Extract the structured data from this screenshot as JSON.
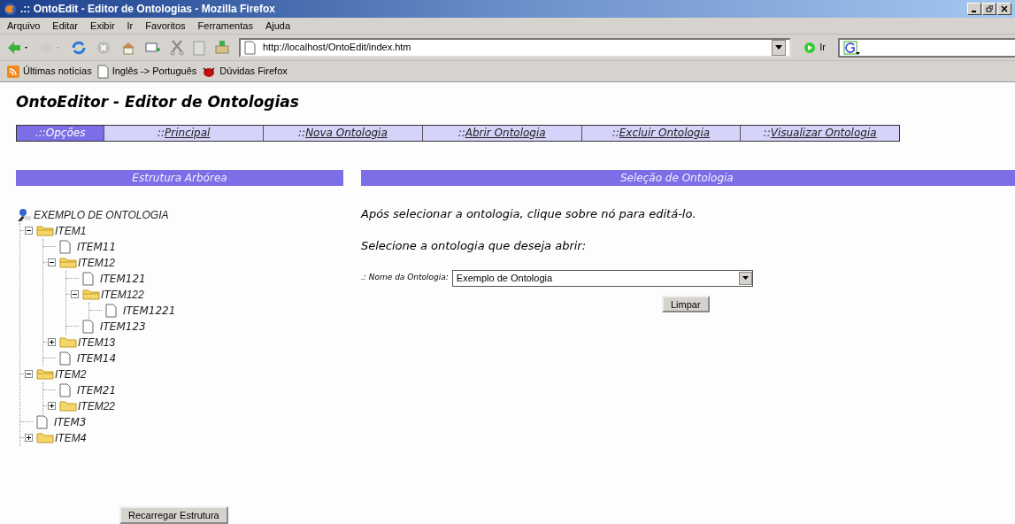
{
  "window": {
    "title": ".:: OntoEdit - Editor de Ontologias - Mozilla Firefox"
  },
  "menu": [
    "Arquivo",
    "Editar",
    "Exibir",
    "Ir",
    "Favoritos",
    "Ferramentas",
    "Ajuda"
  ],
  "address": {
    "value": "http://localhost/OntoEdit/index.htm",
    "go": "Ir"
  },
  "bookmarks": [
    {
      "kind": "feed",
      "label": "Últimas notícias"
    },
    {
      "kind": "page",
      "label": "Inglês -> Português"
    },
    {
      "kind": "bug",
      "label": "Dúvidas Firefox"
    }
  ],
  "page_title": "OntoEditor - Editor de Ontologias",
  "nav": [
    {
      "prefix": ".:: ",
      "label": "Opções",
      "selected": true
    },
    {
      "prefix": ":: ",
      "label": "Principal",
      "selected": false
    },
    {
      "prefix": "::",
      "label": "Nova Ontologia",
      "selected": false
    },
    {
      "prefix": "::",
      "label": "Abrir Ontologia",
      "selected": false
    },
    {
      "prefix": "::",
      "label": "Excluir Ontologia",
      "selected": false
    },
    {
      "prefix": "::",
      "label": "Visualizar Ontologia",
      "selected": false
    }
  ],
  "tree_panel": {
    "header": "Estrutura Arbórea",
    "root": "EXEMPLO DE ONTOLOGIA",
    "button": "Recarregar Estrutura",
    "items": [
      {
        "kind": "folder",
        "label": "ITEM1",
        "expanded": true,
        "children": [
          {
            "kind": "file",
            "label": "ITEM11"
          },
          {
            "kind": "folder",
            "label": "ITEM12",
            "expanded": true,
            "children": [
              {
                "kind": "file",
                "label": "ITEM121"
              },
              {
                "kind": "folder",
                "label": "ITEM122",
                "expanded": true,
                "children": [
                  {
                    "kind": "file",
                    "label": "ITEM1221"
                  }
                ]
              },
              {
                "kind": "file",
                "label": "ITEM123"
              }
            ]
          },
          {
            "kind": "folder",
            "label": "ITEM13",
            "expanded": false
          },
          {
            "kind": "file",
            "label": "ITEM14"
          }
        ]
      },
      {
        "kind": "folder",
        "label": "ITEM2",
        "expanded": true,
        "children": [
          {
            "kind": "file",
            "label": "ITEM21"
          },
          {
            "kind": "folder",
            "label": "ITEM22",
            "expanded": false
          }
        ]
      },
      {
        "kind": "file",
        "label": "ITEM3"
      },
      {
        "kind": "folder",
        "label": "ITEM4",
        "expanded": false
      }
    ]
  },
  "selection_panel": {
    "header": "Seleção de Ontologia",
    "instruction": "Após selecionar a ontologia, clique sobre nó para editá-lo.",
    "prompt": "Selecione a ontologia que deseja abrir:",
    "field_label": ".: Nome da Ontologia:",
    "field_value": "Exemplo de Ontologia",
    "button": "Limpar"
  }
}
